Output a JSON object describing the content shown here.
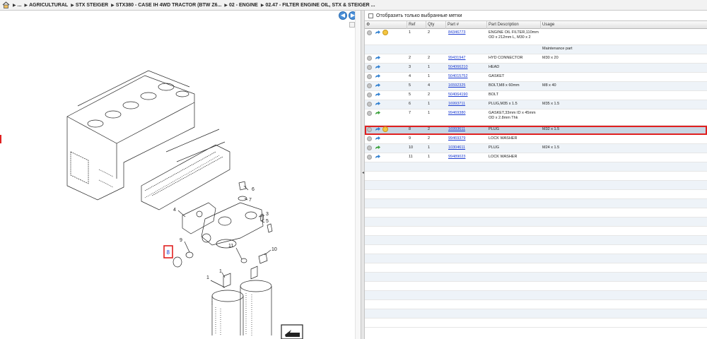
{
  "breadcrumb": {
    "items": [
      "...",
      "AGRICULTURAL",
      "STX STEIGER",
      "STX380 - CASE IH 4WD TRACTOR (BTW Z6...",
      "02 - ENGINE",
      "02.47 - FILTER ENGINE OIL, STX & STEIGER ..."
    ]
  },
  "filter": {
    "label": "Отобразить только выбранные метки"
  },
  "grid": {
    "headers": {
      "ref": "Ref",
      "qty": "Qty",
      "part": "Part #",
      "desc": "Part Description",
      "usage": "Usage"
    },
    "rows": [
      {
        "ref": "1",
        "qty": "2",
        "part": "84346773",
        "desc1": "ENGINE OIL FILTER,110mm",
        "desc2": "OD x 212mm L, M30 x 2",
        "usage": "",
        "arrow": "blue",
        "bulb": true
      },
      {
        "ref": "",
        "qty": "",
        "part": "",
        "desc1": "",
        "desc2": "",
        "usage": "Maintenance part",
        "blank": true
      },
      {
        "ref": "2",
        "qty": "2",
        "part": "99431947",
        "desc1": "HYD CONNECTOR",
        "desc2": "",
        "usage": "M30 x 20",
        "arrow": "blue"
      },
      {
        "ref": "3",
        "qty": "1",
        "part": "504066210",
        "desc1": "HEAD",
        "desc2": "",
        "usage": "",
        "arrow": "blue"
      },
      {
        "ref": "4",
        "qty": "1",
        "part": "504015752",
        "desc1": "GASKET",
        "desc2": "",
        "usage": "",
        "arrow": "blue"
      },
      {
        "ref": "5",
        "qty": "4",
        "part": "16592325",
        "desc1": "BOLT,M8 x 60mm",
        "desc2": "",
        "usage": "M8 x 40",
        "arrow": "blue"
      },
      {
        "ref": "5",
        "qty": "2",
        "part": "504064190",
        "desc1": "BOLT",
        "desc2": "",
        "usage": "",
        "arrow": "blue"
      },
      {
        "ref": "6",
        "qty": "1",
        "part": "16993711",
        "desc1": "PLUG,M35 x 1.5",
        "desc2": "",
        "usage": "M35 x 1.5",
        "arrow": "blue"
      },
      {
        "ref": "7",
        "qty": "1",
        "part": "99469380",
        "desc1": "GASKET,33mm ID x 45mm",
        "desc2": "OD x 2.8mm Thk",
        "usage": "",
        "arrow": "green"
      },
      {
        "ref": "8",
        "qty": "2",
        "part": "16993611",
        "desc1": "PLUG",
        "desc2": "",
        "usage": "M32 x 1.5",
        "arrow": "blue",
        "bulb": true,
        "selected": true
      },
      {
        "ref": "9",
        "qty": "2",
        "part": "99469379",
        "desc1": "LOCK WASHER",
        "desc2": "",
        "usage": "",
        "arrow": "blue"
      },
      {
        "ref": "10",
        "qty": "1",
        "part": "10304611",
        "desc1": "PLUG",
        "desc2": "",
        "usage": "M24 x 1.5",
        "arrow": "green"
      },
      {
        "ref": "11",
        "qty": "1",
        "part": "99489023",
        "desc1": "LOCK WASHER",
        "desc2": "",
        "usage": "",
        "arrow": "blue"
      }
    ]
  },
  "diagram": {
    "callouts": [
      "1",
      "1",
      "3",
      "4",
      "5",
      "6",
      "7",
      "8",
      "9",
      "10",
      "11"
    ]
  },
  "colors": {
    "selection": "#e02020",
    "link": "#1a3ad0",
    "nav": "#4a8fd8"
  }
}
